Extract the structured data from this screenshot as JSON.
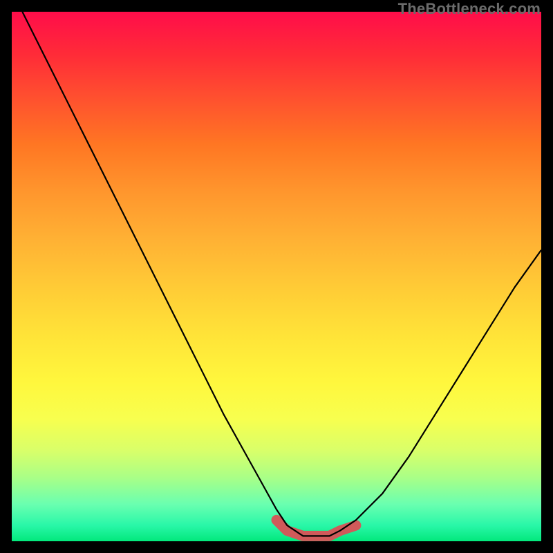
{
  "watermark": "TheBottleneck.com",
  "colors": {
    "background": "#000000",
    "curve": "#000000",
    "trough_highlight": "#d05a5a",
    "gradient_top": "#ff0d4a",
    "gradient_bottom": "#02e87c"
  },
  "chart_data": {
    "type": "line",
    "title": "",
    "xlabel": "",
    "ylabel": "",
    "xlim": [
      0,
      100
    ],
    "ylim": [
      0,
      100
    ],
    "annotations": [
      "Gradient background from red (top) to green (bottom)",
      "Salmon-colored highlight band along trough of curve"
    ],
    "series": [
      {
        "name": "curve",
        "x": [
          2,
          5,
          10,
          15,
          20,
          25,
          30,
          35,
          40,
          45,
          50,
          52,
          55,
          58,
          60,
          62,
          65,
          70,
          75,
          80,
          85,
          90,
          95,
          100
        ],
        "y": [
          100,
          94,
          84,
          74,
          64,
          54,
          44,
          34,
          24,
          15,
          6,
          3,
          1,
          1,
          1,
          2,
          4,
          9,
          16,
          24,
          32,
          40,
          48,
          55
        ]
      },
      {
        "name": "trough-highlight",
        "x": [
          50,
          52,
          55,
          58,
          60,
          62,
          65
        ],
        "y": [
          4,
          2,
          1,
          1,
          1,
          2,
          3
        ]
      }
    ]
  }
}
